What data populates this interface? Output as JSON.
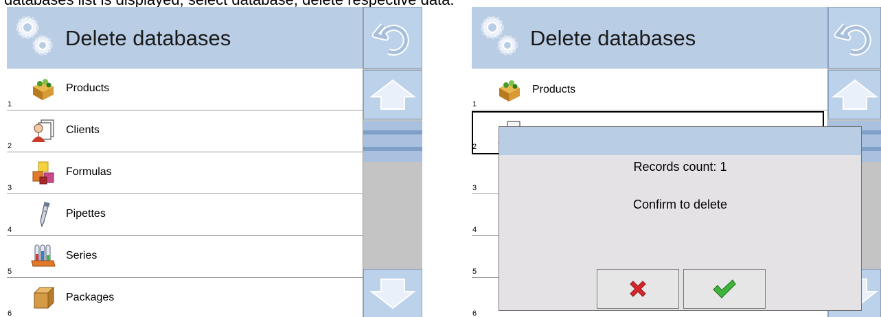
{
  "caption": "databases list is displayed, select database, delete respective data.",
  "screens": [
    {
      "title": "Delete databases",
      "items": [
        {
          "num": "1",
          "label": "Products"
        },
        {
          "num": "2",
          "label": "Clients"
        },
        {
          "num": "3",
          "label": "Formulas"
        },
        {
          "num": "4",
          "label": "Pipettes"
        },
        {
          "num": "5",
          "label": "Series"
        },
        {
          "num": "6",
          "label": "Packages"
        }
      ]
    },
    {
      "title": "Delete databases",
      "items": [
        {
          "num": "1",
          "label": "Products"
        },
        {
          "num": "2",
          "label": ""
        },
        {
          "num": "3",
          "label": ""
        },
        {
          "num": "4",
          "label": ""
        },
        {
          "num": "5",
          "label": ""
        },
        {
          "num": "6",
          "label": ""
        }
      ]
    }
  ],
  "dialog": {
    "records_text": "Records count: 1",
    "confirm_text": "Confirm to delete"
  },
  "icons": {
    "header": "gears-icon",
    "back": "back-arrow-icon",
    "up": "arrow-up-icon",
    "down": "arrow-down-icon",
    "cancel": "red-x-icon",
    "ok": "green-check-icon"
  },
  "colors": {
    "header_bg": "#b9cde5",
    "button_bg": "#bcd1ea",
    "sidebar_bg": "#c4c4c4",
    "dialog_bg": "#e5e2e5",
    "cancel": "#d9262b",
    "ok": "#3fb43a"
  }
}
